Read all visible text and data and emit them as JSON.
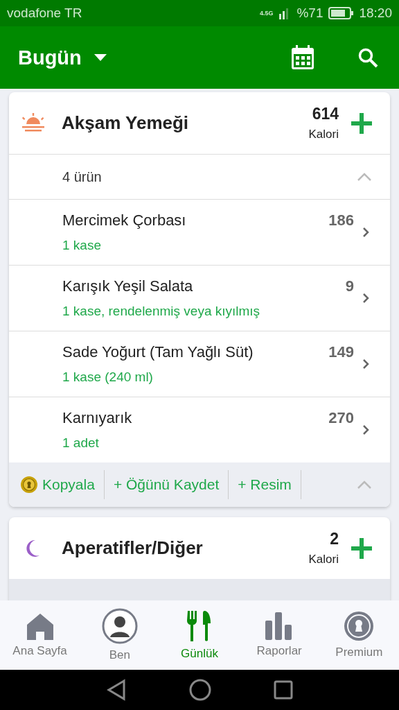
{
  "status_bar": {
    "carrier": "vodafone TR",
    "network": "4.5G",
    "battery": "%71",
    "time": "18:20"
  },
  "app_bar": {
    "title": "Bugün"
  },
  "meals": [
    {
      "kind": "sunset",
      "name": "Akşam Yemeği",
      "calories": "614",
      "calories_label": "Kalori",
      "count": "4 ürün",
      "expanded": true,
      "items": [
        {
          "name": "Mercimek Çorbası",
          "portion": "1 kase",
          "calories": "186"
        },
        {
          "name": "Karışık Yeşil Salata",
          "portion": "1 kase, rendelenmiş veya kıyılmış",
          "calories": "9"
        },
        {
          "name": "Sade Yoğurt (Tam Yağlı Süt)",
          "portion": "1 kase (240 ml)",
          "calories": "149"
        },
        {
          "name": "Karnıyarık",
          "portion": "1 adet",
          "calories": "270"
        }
      ],
      "actions": [
        "Kopyala",
        "+ Öğünü Kaydet",
        "+ Resim"
      ]
    },
    {
      "kind": "moon",
      "name": "Aperatifler/Diğer",
      "calories": "2",
      "calories_label": "Kalori",
      "expanded": false
    }
  ],
  "tabs": [
    {
      "kind": "home",
      "label": "Ana Sayfa",
      "selected": false
    },
    {
      "kind": "avatar",
      "label": "Ben",
      "selected": false
    },
    {
      "kind": "diary",
      "label": "Günlük",
      "selected": true
    },
    {
      "kind": "reports",
      "label": "Raporlar",
      "selected": false
    },
    {
      "kind": "premium",
      "label": "Premium",
      "selected": false
    }
  ]
}
